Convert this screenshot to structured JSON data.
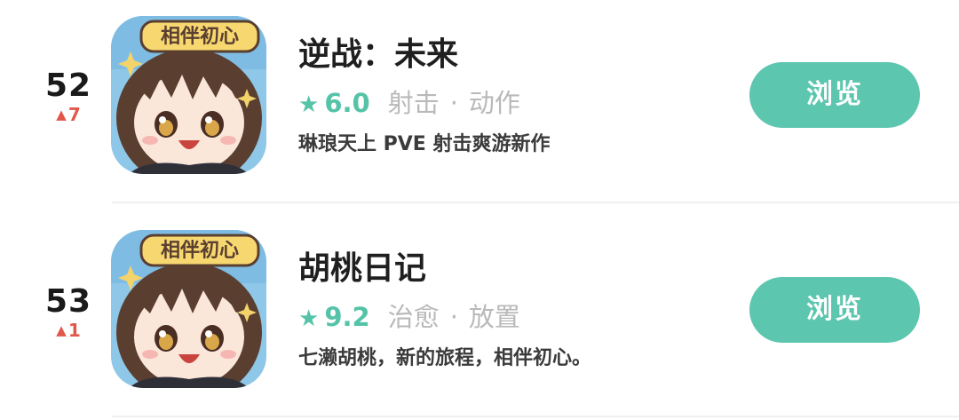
{
  "list": [
    {
      "rank": "52",
      "rank_change": "7",
      "title": "逆战：未来",
      "rating": "6.0",
      "tags": [
        "射击",
        "动作"
      ],
      "separator": "·",
      "description": "琳琅天上 PVE 射击爽游新作",
      "icon_banner": "相伴初心",
      "button_label": "浏览"
    },
    {
      "rank": "53",
      "rank_change": "1",
      "title": "胡桃日记",
      "rating": "9.2",
      "tags": [
        "治愈",
        "放置"
      ],
      "separator": "·",
      "description": "七濑胡桃，新的旅程，相伴初心。",
      "icon_banner": "相伴初心",
      "button_label": "浏览"
    }
  ],
  "icons": {
    "star": "star-icon",
    "rank_up": "triangle-up-icon"
  },
  "colors": {
    "accent": "#5cc6ae",
    "rank_up": "#e2574c",
    "muted": "#b9b9b9"
  }
}
